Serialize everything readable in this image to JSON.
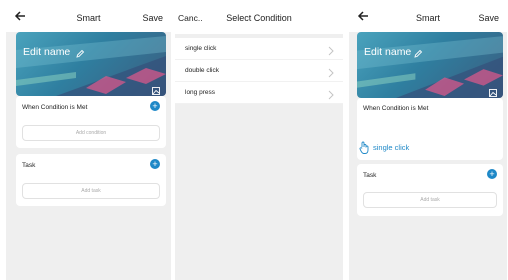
{
  "screen_left": {
    "title": "Smart",
    "save_label": "Save",
    "banner_title": "Edit name",
    "condition_section": {
      "heading": "When Condition is Met",
      "placeholder": "Add condition"
    },
    "task_section": {
      "heading": "Task",
      "placeholder": "Add task"
    }
  },
  "screen_middle": {
    "cancel_label": "Canc..",
    "title": "Select Condition",
    "options": [
      {
        "label": "single click"
      },
      {
        "label": "double click"
      },
      {
        "label": "long press"
      }
    ]
  },
  "screen_right": {
    "title": "Smart",
    "save_label": "Save",
    "banner_title": "Edit name",
    "condition_section": {
      "heading": "When Condition is Met",
      "selected": "single click"
    },
    "task_section": {
      "heading": "Task",
      "placeholder": "Add task"
    }
  },
  "colors": {
    "accent": "#1e88c7",
    "background": "#efefef",
    "card": "#ffffff"
  },
  "icons": [
    "back-arrow-icon",
    "pencil-icon",
    "image-icon",
    "plus-icon",
    "chevron-right-icon",
    "hand-tap-icon"
  ]
}
